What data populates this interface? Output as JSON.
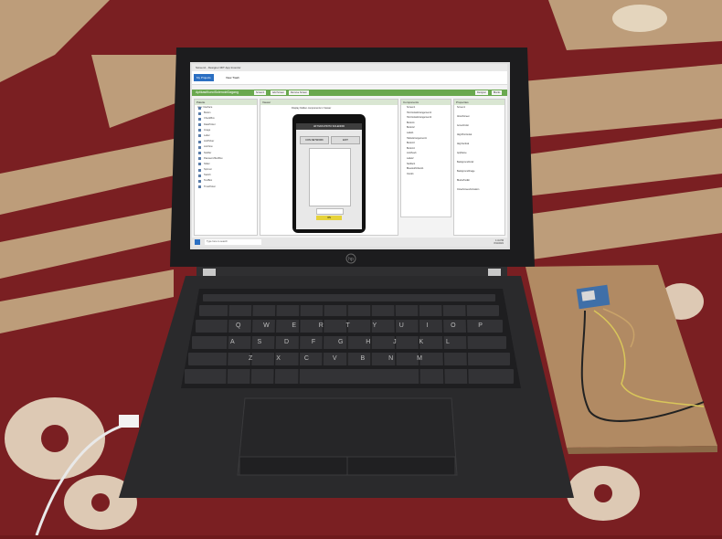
{
  "window": {
    "title": "Screen1 - Designer MIT App Inventor"
  },
  "menubar": {
    "items": [
      "My Projects",
      "View Trash"
    ]
  },
  "project": {
    "name": "AplikasiKunciSolenoidGagang",
    "buttons": [
      "Screen1",
      "Add Screen",
      "Remove Screen"
    ],
    "right_buttons": [
      "Designer",
      "Blocks"
    ]
  },
  "palette": {
    "header": "Palette",
    "section": "User Interface",
    "items": [
      "Button",
      "CheckBox",
      "DatePicker",
      "Image",
      "Label",
      "ListPicker",
      "ListView",
      "Notifier",
      "PasswordTextBox",
      "Slider",
      "Spinner",
      "Switch",
      "TextBox",
      "TimePicker"
    ]
  },
  "viewer": {
    "header": "Viewer",
    "checkbox_label": "Display hidden components in Viewer",
    "app_title": "AKTIVASI PINTU SOLENOID",
    "btn_left": "CON NETWORK",
    "btn_right": "EXIT",
    "box_bottom": "ON"
  },
  "components": {
    "header": "Components",
    "items": [
      "Screen1",
      "HorizontalArrangement1",
      "HorizontalArrangement2",
      "Button1",
      "Button2",
      "Label1",
      "TableArrangement1",
      "Button3",
      "Button4",
      "ListView1",
      "Label2",
      "Notifier1",
      "BluetoothClient1",
      "Clock1"
    ]
  },
  "properties": {
    "header": "Properties",
    "items": [
      "Screen1",
      "AboutScreen",
      "AccentColor",
      "AlignHorizontal",
      "AlignVertical",
      "AppName",
      "BackgroundColor",
      "BackgroundImage",
      "BlocksToolkit",
      "CloseScreenAnimation"
    ]
  },
  "taskbar": {
    "search": "Type here to search",
    "time": "1:41 PM",
    "date": "8/11/2021"
  },
  "laptop": {
    "brand": "hp"
  },
  "keyboard_rows": [
    [
      "Q",
      "W",
      "E",
      "R",
      "T",
      "Y",
      "U",
      "I",
      "O",
      "P"
    ],
    [
      "A",
      "S",
      "D",
      "F",
      "G",
      "H",
      "J",
      "K",
      "L"
    ],
    [
      "Z",
      "X",
      "C",
      "V",
      "B",
      "N",
      "M"
    ]
  ],
  "colors": {
    "carpet_red": "#7a1f22",
    "carpet_stripe": "#c9b48a",
    "laptop_body": "#2a2a2c",
    "app_green": "#6aa84f",
    "board_wood": "#b18a63",
    "module_blue": "#3f6fa8"
  }
}
